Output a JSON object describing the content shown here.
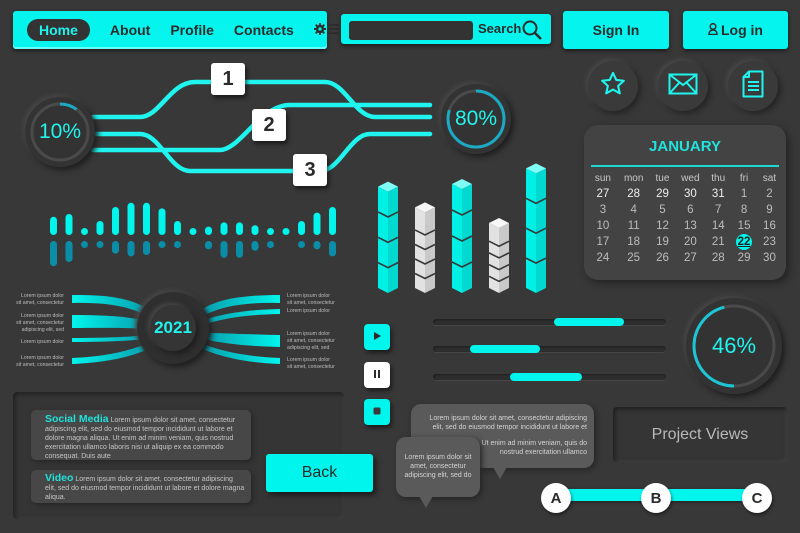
{
  "nav": {
    "items": [
      "Home",
      "About",
      "Profile",
      "Contacts"
    ],
    "active": "Home",
    "settings_icon": "gear-menu-icon"
  },
  "search": {
    "value": "",
    "placeholder": "",
    "label": "Search",
    "icon": "search-icon"
  },
  "auth": {
    "sign_in": "Sign In",
    "log_in": "Log in",
    "log_in_icon": "user-icon"
  },
  "quick_icons": [
    "star-icon",
    "mail-icon",
    "document-icon"
  ],
  "flow": {
    "start_percent": "10%",
    "end_percent": "80%",
    "start_value": 0.1,
    "end_value": 0.8,
    "steps": [
      "1",
      "2",
      "3"
    ]
  },
  "calendar": {
    "month": "JANUARY",
    "weekdays": [
      "sun",
      "mon",
      "tue",
      "wed",
      "thu",
      "fri",
      "sat"
    ],
    "weeks": [
      [
        "27",
        "28",
        "29",
        "30",
        "31",
        "1",
        "2"
      ],
      [
        "3",
        "4",
        "5",
        "6",
        "7",
        "8",
        "9"
      ],
      [
        "10",
        "11",
        "12",
        "13",
        "14",
        "15",
        "16"
      ],
      [
        "17",
        "18",
        "19",
        "20",
        "21",
        "22",
        "23"
      ],
      [
        "24",
        "25",
        "26",
        "27",
        "28",
        "29",
        "30"
      ]
    ],
    "selected": "22"
  },
  "equalizer": {
    "top_levels": [
      0.65,
      0.75,
      0.25,
      0.5,
      1.0,
      1.15,
      1.15,
      0.95,
      0.5,
      0.15,
      0.3,
      0.45,
      0.45,
      0.35,
      0.15,
      0.2,
      0.5,
      0.8,
      1.0
    ],
    "bottom_levels": [
      0.9,
      0.75,
      0.15,
      0.15,
      0.45,
      0.55,
      0.5,
      0.25,
      0.15,
      0.0,
      0.3,
      0.6,
      0.6,
      0.35,
      0.15,
      0.0,
      0.15,
      0.3,
      0.55
    ]
  },
  "bars3d": {
    "heights": [
      0.78,
      0.62,
      0.8,
      0.5,
      0.92
    ],
    "colors": [
      "cyan",
      "white",
      "cyan",
      "white",
      "cyan"
    ]
  },
  "timeline": {
    "year": "2021",
    "left_labels": [
      "Lorem ipsum dolor\nsit amet, consectetur",
      "Lorem ipsum dolor\nsit amet, consectetur\nadipiscing elit, sed",
      "Lorem ipsum dolor",
      "Lorem ipsum dolor\nsit amet, consectetur"
    ],
    "right_labels": [
      "Lorem ipsum dolor\nsit amet, consectetur",
      "Lorem ipsum dolor",
      "Lorem ipsum dolor\nsit amet, consectetur\nadipiscing elit, sed",
      "Lorem ipsum dolor\nsit amet, consectetur"
    ]
  },
  "media": {
    "play_icon": "play-icon",
    "pause_icon": "pause-icon",
    "stop_icon": "stop-icon"
  },
  "sliders": [
    {
      "start": 0.52,
      "end": 0.82
    },
    {
      "start": 0.16,
      "end": 0.46
    },
    {
      "start": 0.33,
      "end": 0.64
    }
  ],
  "gauge": {
    "label": "46%",
    "value": 0.46
  },
  "cards": [
    {
      "title": "Social Media",
      "text": "Lorem ipsum dolor sit amet, consectetur adipiscing elit, sed do eiusmod tempor incididunt ut labore et dolore magna aliqua. Ut enim ad minim veniam, quis nostrud exercitation ullamco laboris nisi ut aliquip ex ea commodo consequat. Duis aute"
    },
    {
      "title": "Video",
      "text": "Lorem ipsum dolor sit amet, consectetur adipiscing elit, sed do eiusmod tempor incididunt ut labore et dolore magna aliqua."
    }
  ],
  "back_label": "Back",
  "bubbles": {
    "large_1": "Lorem ipsum dolor sit amet, consectetur adipiscing elit, sed do eiusmod tempor incididunt ut labore et",
    "large_2": "Ut enim ad minim veniam, quis do nostrud exercitation ullamco",
    "small": "Lorem ipsum dolor sit amet, consectetur adipiscing elit, sed do"
  },
  "project_views_label": "Project Views",
  "stepper": {
    "steps": [
      "A",
      "B",
      "C"
    ]
  },
  "colors": {
    "accent": "#00f5ec",
    "background": "#383838",
    "text_dark": "#2b2b2b"
  }
}
